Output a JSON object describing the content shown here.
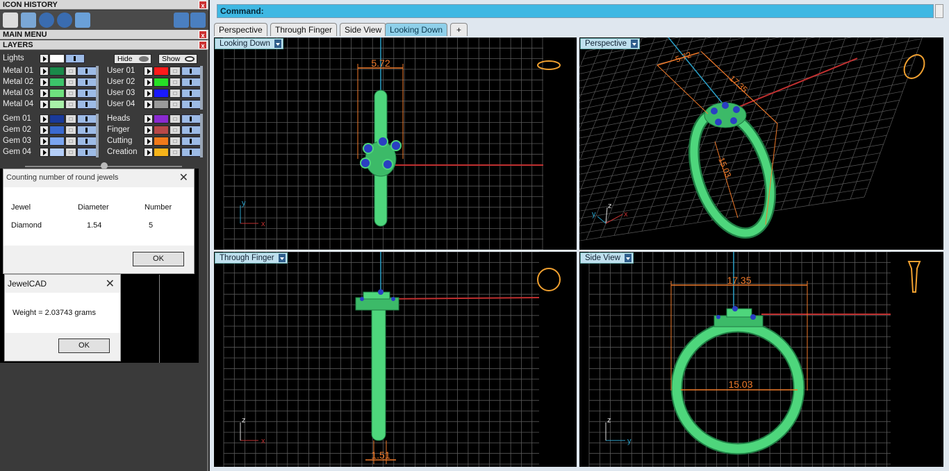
{
  "left_panel": {
    "icon_history": "ICON HISTORY",
    "main_menu": "MAIN MENU",
    "layers": "LAYERS",
    "close": "x",
    "lights": "Lights",
    "hide_label": "Hide",
    "show_label": "Show",
    "metal_group": [
      {
        "name": "Metal 01",
        "color": "#1a8a4a"
      },
      {
        "name": "Metal 02",
        "color": "#3cc46a"
      },
      {
        "name": "Metal 03",
        "color": "#6ee07e"
      },
      {
        "name": "Metal 04",
        "color": "#a8f0a8"
      }
    ],
    "user_group": [
      {
        "name": "User 01",
        "color": "#ff1a1a"
      },
      {
        "name": "User 02",
        "color": "#26e026"
      },
      {
        "name": "User 03",
        "color": "#1a1aff"
      },
      {
        "name": "User 04",
        "color": "#9a9a9a"
      }
    ],
    "gem_group": [
      {
        "name": "Gem 01",
        "color": "#1a3a9a"
      },
      {
        "name": "Gem 02",
        "color": "#3a6ad0"
      },
      {
        "name": "Gem 03",
        "color": "#7aa6f0"
      },
      {
        "name": "Gem 04",
        "color": "#b4cef8"
      }
    ],
    "misc_group": [
      {
        "name": "Heads",
        "color": "#8a2ad0"
      },
      {
        "name": "Finger",
        "color": "#b84848"
      },
      {
        "name": "Cutting",
        "color": "#f07a1a"
      },
      {
        "name": "Creation",
        "color": "#f6b41a"
      }
    ]
  },
  "jewel_dialog": {
    "title": "Counting number of round jewels",
    "headers": [
      "Jewel",
      "Diameter",
      "Number"
    ],
    "row": [
      "Diamond",
      "1.54",
      "5"
    ],
    "ok": "OK"
  },
  "weight_dialog": {
    "title": "JewelCAD",
    "message": "Weight = 2.03743 grams",
    "ok": "OK"
  },
  "command": {
    "label": "Command:"
  },
  "tabs": [
    {
      "label": "Perspective",
      "active": false
    },
    {
      "label": "Through Finger",
      "active": false
    },
    {
      "label": "Side View",
      "active": false
    },
    {
      "label": "Looking Down",
      "active": true
    }
  ],
  "add_tab": "+",
  "viewports": {
    "top_left": {
      "label": "Looking Down",
      "dim": "5.72",
      "axis_a": "y",
      "axis_b": "x"
    },
    "top_right": {
      "label": "Perspective",
      "dim_a": "5.72",
      "dim_b": "17.35",
      "dim_c": "15.03",
      "axis_a": "z",
      "axis_b": "x",
      "axis_c": "y"
    },
    "bottom_left": {
      "label": "Through Finger",
      "dim": "1.51",
      "axis_a": "z",
      "axis_b": "x"
    },
    "bottom_right": {
      "label": "Side View",
      "dim_a": "17.35",
      "dim_b": "15.03",
      "axis_a": "z",
      "axis_b": "y"
    }
  },
  "colors": {
    "ring": "#4ed67c",
    "ring_dark": "#1f7a43",
    "gem": "#2a3fc2",
    "grid": "#5a5a5a",
    "dimension": "#f07a2a",
    "axis_red": "#c03030",
    "axis_blue": "#2aa0c8"
  }
}
